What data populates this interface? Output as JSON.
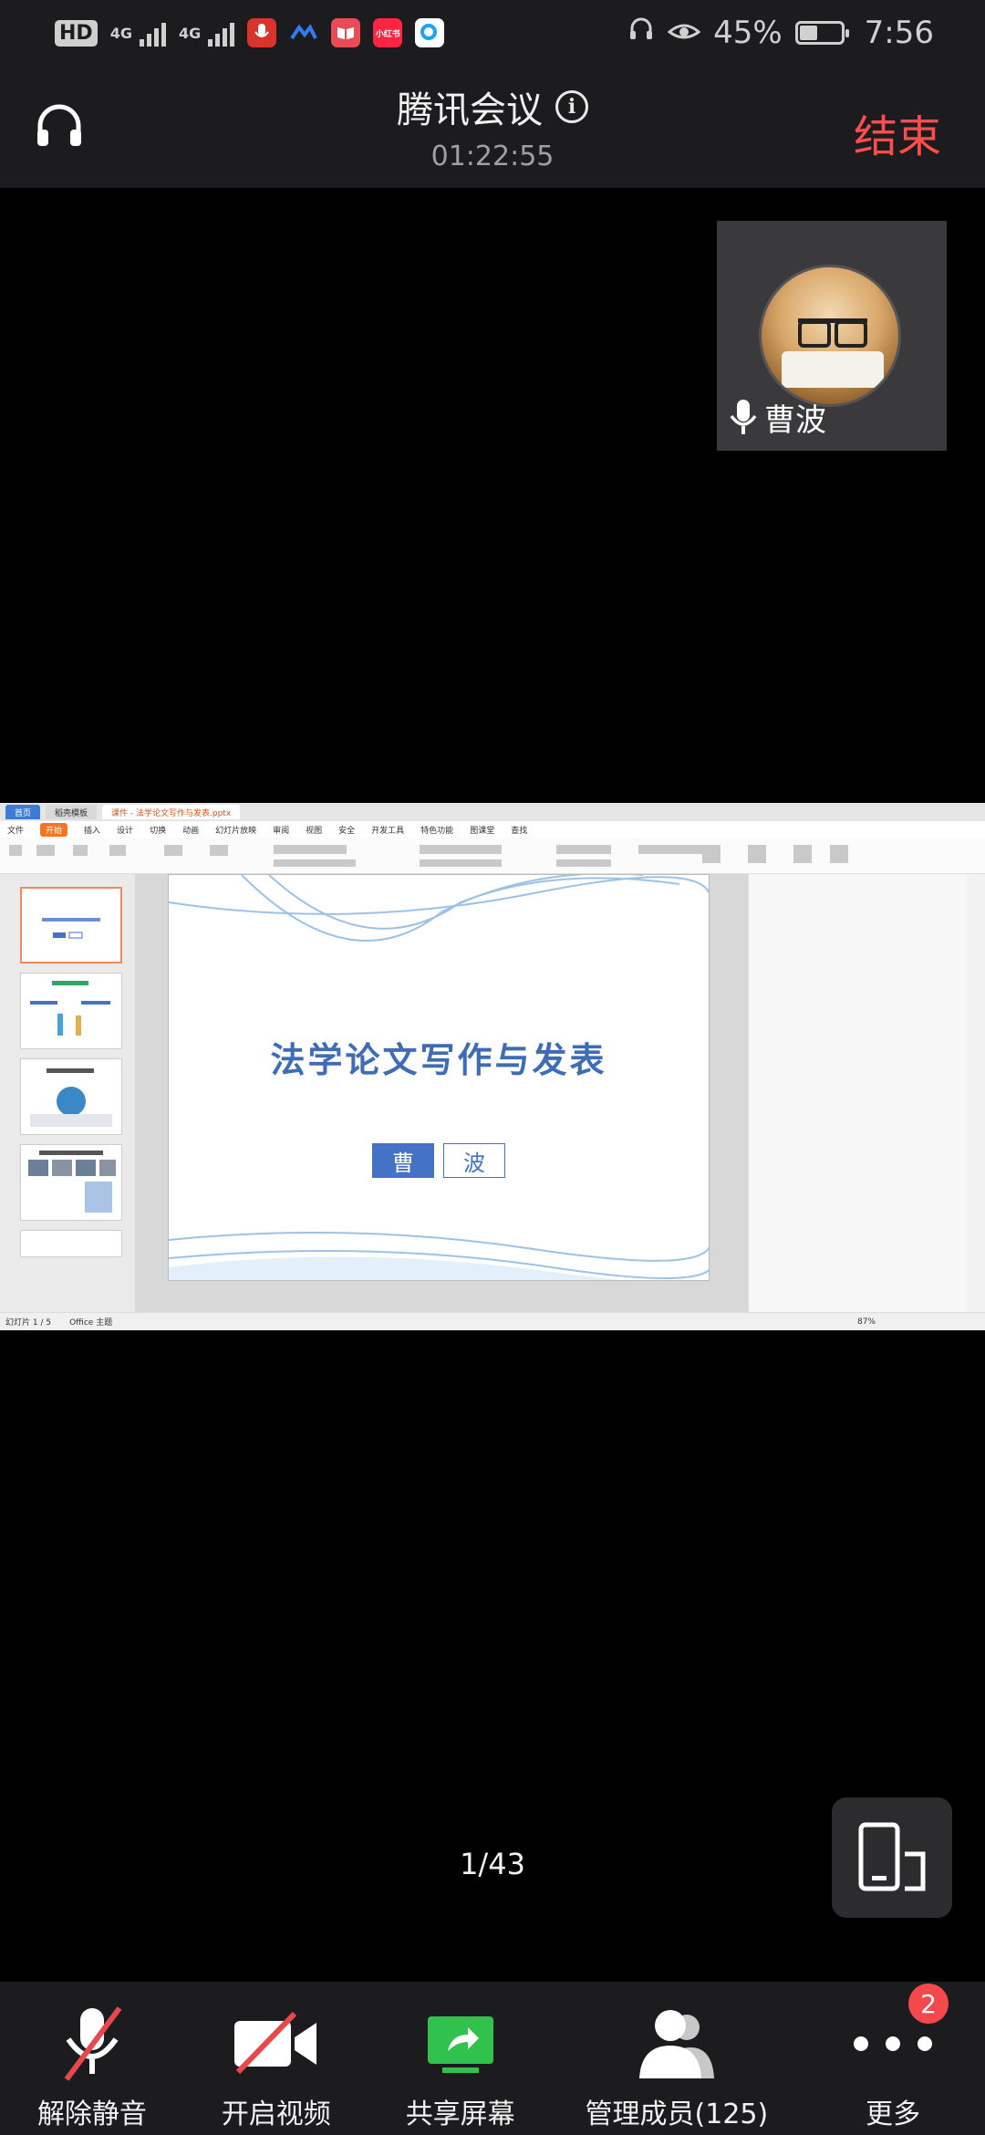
{
  "status_bar": {
    "hd_label": "HD",
    "network_1": "4G",
    "network_2": "4G",
    "battery": "45%",
    "battery_fraction": 0.45,
    "time": "7:56",
    "app_icons": [
      "microphone-app-icon",
      "blue-bird-app-icon",
      "book-app-icon",
      "xiaohongshu-app-icon",
      "search-app-icon"
    ],
    "xiaohongshu_text": "小红书"
  },
  "header": {
    "title": "腾讯会议",
    "timer": "01:22:55",
    "end_label": "结束"
  },
  "participant": {
    "name": "曹波"
  },
  "shared_screen": {
    "tabs": [
      "首页",
      "稻壳模板",
      "课件 - 法学论文写作与发表.pptx"
    ],
    "menu": [
      "文件",
      "开始",
      "插入",
      "设计",
      "切换",
      "动画",
      "幻灯片放映",
      "审阅",
      "视图",
      "安全",
      "开发工具",
      "特色功能",
      "图课堂",
      "查找"
    ],
    "slide_title": "法学论文写作与发表",
    "name_char_1": "曹",
    "name_char_2": "波",
    "status_text": "幻灯片 1 / 5",
    "theme_text": "Office 主题",
    "zoom_text": "87%"
  },
  "page_indicator": "1/43",
  "toolbar": {
    "unmute": "解除静音",
    "video": "开启视频",
    "share": "共享屏幕",
    "members": "管理成员(125)",
    "more": "更多",
    "more_badge": "2"
  },
  "colors": {
    "end_red": "#ff4d4f",
    "share_green": "#31c24d",
    "mute_red": "#e8474c",
    "slide_blue": "#4472c4"
  }
}
